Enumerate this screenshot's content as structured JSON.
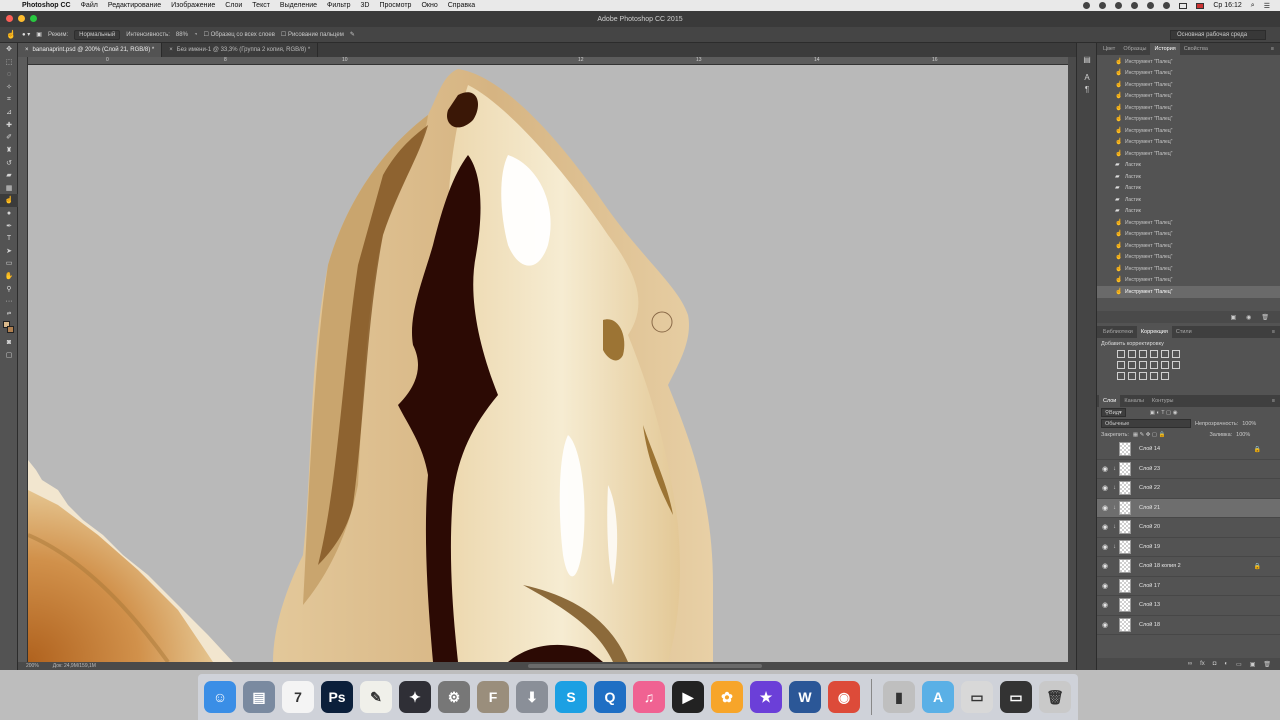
{
  "menubar": {
    "app": "Photoshop CC",
    "items": [
      "Файл",
      "Редактирование",
      "Изображение",
      "Слои",
      "Текст",
      "Выделение",
      "Фильтр",
      "3D",
      "Просмотр",
      "Окно",
      "Справка"
    ],
    "clock": "Ср 16:12"
  },
  "window": {
    "title": "Adobe Photoshop CC 2015"
  },
  "options": {
    "mode_label": "Режим:",
    "mode_value": "Нормальный",
    "intensity_label": "Интенсивность:",
    "intensity_value": "88%",
    "all_layers": "Образец со всех слоев",
    "finger": "Рисование пальцем",
    "workspace": "Основная рабочая среда"
  },
  "tabs": [
    {
      "label": "bananaprint.psd @ 200% (Слой 21, RGB/8) *"
    },
    {
      "label": "Без имени-1 @ 33,3% (Группа 2 копия, RGB/8) *"
    }
  ],
  "ruler_labels": [
    "0",
    "8",
    "10",
    "12",
    "13",
    "14",
    "16"
  ],
  "status": {
    "zoom": "200%",
    "doc": "Док: 24,9M/159,1M"
  },
  "history": {
    "tabs": [
      "Цвет",
      "Образцы",
      "История",
      "Свойства"
    ],
    "active_tab": "История",
    "items": [
      "Инструмент \"Палец\"",
      "Инструмент \"Палец\"",
      "Инструмент \"Палец\"",
      "Инструмент \"Палец\"",
      "Инструмент \"Палец\"",
      "Инструмент \"Палец\"",
      "Инструмент \"Палец\"",
      "Инструмент \"Палец\"",
      "Инструмент \"Палец\"",
      "Ластик",
      "Ластик",
      "Ластик",
      "Ластик",
      "Ластик",
      "Инструмент \"Палец\"",
      "Инструмент \"Палец\"",
      "Инструмент \"Палец\"",
      "Инструмент \"Палец\"",
      "Инструмент \"Палец\"",
      "Инструмент \"Палец\"",
      "Инструмент \"Палец\""
    ]
  },
  "adjustments": {
    "tabs": [
      "Библиотеки",
      "Коррекция",
      "Стили"
    ],
    "active_tab": "Коррекция",
    "hint": "Добавить корректировку"
  },
  "layers_panel": {
    "tabs": [
      "Слои",
      "Каналы",
      "Контуры"
    ],
    "active_tab": "Слои",
    "filter": "Вид",
    "blend": "Обычные",
    "opacity_label": "Непрозрачность:",
    "opacity_value": "100%",
    "lock_label": "Закрепить:",
    "fill_label": "Заливка:",
    "fill_value": "100%",
    "layers": [
      {
        "name": "Слой 14",
        "visible": false,
        "clip": false,
        "locked": true,
        "selected": false
      },
      {
        "name": "Слой 23",
        "visible": true,
        "clip": true,
        "locked": false,
        "selected": false
      },
      {
        "name": "Слой 22",
        "visible": true,
        "clip": true,
        "locked": false,
        "selected": false
      },
      {
        "name": "Слой 21",
        "visible": true,
        "clip": true,
        "locked": false,
        "selected": true
      },
      {
        "name": "Слой 20",
        "visible": true,
        "clip": true,
        "locked": false,
        "selected": false
      },
      {
        "name": "Слой 19",
        "visible": true,
        "clip": true,
        "locked": false,
        "selected": false
      },
      {
        "name": "Слой 18 копия 2",
        "visible": true,
        "clip": false,
        "locked": true,
        "selected": false
      },
      {
        "name": "Слой 17",
        "visible": true,
        "clip": false,
        "locked": false,
        "selected": false
      },
      {
        "name": "Слой 13",
        "visible": true,
        "clip": false,
        "locked": false,
        "selected": false
      },
      {
        "name": "Слой 18",
        "visible": true,
        "clip": false,
        "locked": false,
        "selected": false
      }
    ]
  },
  "dock": [
    {
      "name": "finder-icon",
      "glyph": "☺",
      "color": "#3a8ee6"
    },
    {
      "name": "preview-icon",
      "glyph": "▤",
      "color": "#7a8aa0"
    },
    {
      "name": "calendar-icon",
      "glyph": "7",
      "color": "#f4f4f4"
    },
    {
      "name": "photoshop-icon",
      "glyph": "Ps",
      "color": "#0b1f3a"
    },
    {
      "name": "textedit-icon",
      "glyph": "✎",
      "color": "#f0f0ea"
    },
    {
      "name": "launchpad-icon",
      "glyph": "✦",
      "color": "#2f2f36"
    },
    {
      "name": "system-preferences-icon",
      "glyph": "⚙",
      "color": "#777"
    },
    {
      "name": "fontbook-icon",
      "glyph": "F",
      "color": "#9a8e7c"
    },
    {
      "name": "installer-icon",
      "glyph": "⬇",
      "color": "#8a8f98"
    },
    {
      "name": "skype-icon",
      "glyph": "S",
      "color": "#1ca0e3"
    },
    {
      "name": "quicktime-icon",
      "glyph": "Q",
      "color": "#1f6fc4"
    },
    {
      "name": "itunes-icon",
      "glyph": "♫",
      "color": "#f06292"
    },
    {
      "name": "dvd-player-icon",
      "glyph": "▶",
      "color": "#222"
    },
    {
      "name": "photos-icon",
      "glyph": "✿",
      "color": "#f7a52a"
    },
    {
      "name": "imovie-icon",
      "glyph": "★",
      "color": "#6b3fd8"
    },
    {
      "name": "word-icon",
      "glyph": "W",
      "color": "#2b5797"
    },
    {
      "name": "chrome-icon",
      "glyph": "◉",
      "color": "#dd4b39"
    },
    {
      "name": "archive-icon",
      "glyph": "▮",
      "color": "#bfbfbf"
    },
    {
      "name": "applications-folder-icon",
      "glyph": "A",
      "color": "#5ab0e6"
    },
    {
      "name": "document-stack-icon",
      "glyph": "▭",
      "color": "#d8d8d8"
    },
    {
      "name": "screen-stack-icon",
      "glyph": "▭",
      "color": "#333"
    },
    {
      "name": "trash-icon",
      "glyph": "🗑",
      "color": "#c9c9c9"
    }
  ]
}
